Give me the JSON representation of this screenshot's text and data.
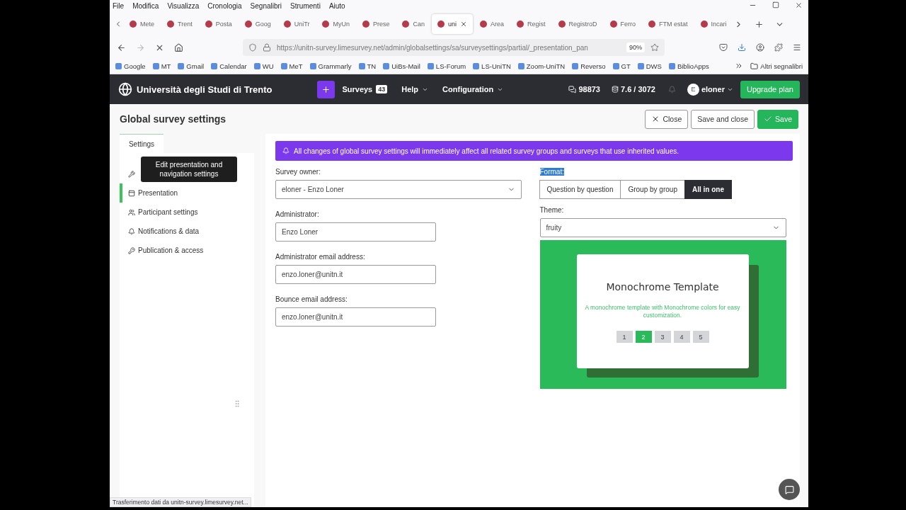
{
  "browser": {
    "menu": [
      "File",
      "Modifica",
      "Visualizza",
      "Cronologia",
      "Segnalibri",
      "Strumenti",
      "Aiuto"
    ],
    "tabs": [
      {
        "label": "Mete",
        "selected": false
      },
      {
        "label": "Trent",
        "selected": false
      },
      {
        "label": "Posta",
        "selected": false
      },
      {
        "label": "Goog",
        "selected": false
      },
      {
        "label": "UniTr",
        "selected": false
      },
      {
        "label": "MyUn",
        "selected": false
      },
      {
        "label": "Prese",
        "selected": false
      },
      {
        "label": "Can",
        "selected": false
      },
      {
        "label": "uni",
        "selected": true
      },
      {
        "label": "Area",
        "selected": false
      },
      {
        "label": "Regist",
        "selected": false
      },
      {
        "label": "RegistroD",
        "selected": false
      },
      {
        "label": "Ferro",
        "selected": false
      },
      {
        "label": "FTM estat",
        "selected": false
      },
      {
        "label": "Incari",
        "selected": false
      }
    ],
    "url": "https://unitn-survey.limesurvey.net/admin/globalsettings/sa/surveysettings/partial/_presentation_pan",
    "zoom": "90%",
    "bookmarks": [
      "Google",
      "MT",
      "Gmail",
      "Calendar",
      "WU",
      "MeT",
      "Grammarly",
      "TN",
      "UiBs-Mail",
      "LS-Forum",
      "LS-UniTN",
      "Zoom-UniTN",
      "Reverso",
      "GT",
      "DWS",
      "BiblioApps"
    ],
    "other_bookmarks": "Altri segnalibri",
    "status": "Trasferimento dati da unitn-survey.limesurvey.net..."
  },
  "app": {
    "brand": "Università degli Studi di Trento",
    "surveys_label": "Surveys",
    "surveys_count": "43",
    "menus": [
      "Help",
      "Configuration"
    ],
    "responses": "98873",
    "storage": "7.6 / 3072",
    "avatar": "E",
    "user": "eloner",
    "upgrade": "Upgrade plan"
  },
  "page": {
    "title": "Global survey settings",
    "actions": [
      {
        "label": "Close",
        "kind": "close"
      },
      {
        "label": "Save and close",
        "kind": "plain"
      },
      {
        "label": "Save",
        "kind": "save"
      }
    ]
  },
  "sidebar": {
    "tab": "Settings",
    "tooltip": "Edit presentation and navigation settings",
    "items": [
      {
        "selected": false
      },
      {
        "label": "Presentation",
        "selected": true
      },
      {
        "label": "Participant settings",
        "selected": false
      },
      {
        "label": "Notifications & data",
        "selected": false
      },
      {
        "label": "Publication & access",
        "selected": false
      }
    ]
  },
  "alert": "All changes of global survey settings will immediately affect all related survey groups and surveys that use inherited values.",
  "fields": [
    {
      "label": "Survey owner:",
      "value": "eloner - Enzo Loner",
      "kind": "select"
    },
    {
      "label": "Administrator:",
      "value": "Enzo Loner",
      "kind": "input"
    },
    {
      "label": "Administrator email address:",
      "value": "enzo.loner@unitn.it",
      "kind": "input"
    },
    {
      "label": "Bounce email address:",
      "value": "enzo.loner@unitn.it",
      "kind": "input"
    }
  ],
  "format": {
    "label": "Format:",
    "highlighted": true,
    "options": [
      {
        "label": "Question by question",
        "selected": false
      },
      {
        "label": "Group by group",
        "selected": false
      },
      {
        "label": "All in one",
        "selected": true
      }
    ]
  },
  "theme": {
    "label": "Theme:",
    "value": "fruity"
  },
  "preview": {
    "title": "Monochrome Template",
    "description": "A monochrome template with Monochrome colors for easy customization.",
    "pages": [
      {
        "label": "1",
        "selected": false
      },
      {
        "label": "2",
        "selected": true
      },
      {
        "label": "3",
        "selected": false
      },
      {
        "label": "4",
        "selected": false
      },
      {
        "label": "5",
        "selected": false
      }
    ]
  }
}
